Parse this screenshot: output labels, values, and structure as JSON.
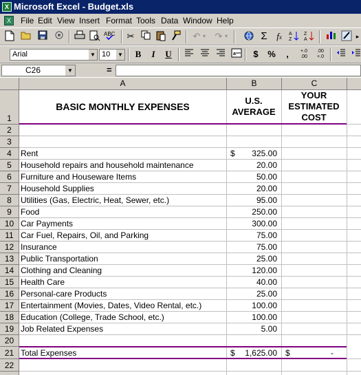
{
  "window": {
    "title": "Microsoft Excel - Budget.xls",
    "app_icon_glyph": "X"
  },
  "menu": [
    "File",
    "Edit",
    "View",
    "Insert",
    "Format",
    "Tools",
    "Data",
    "Window",
    "Help"
  ],
  "font_toolbar": {
    "font_name": "Arial",
    "font_size": "10",
    "bold": "B",
    "italic": "I",
    "underline": "U",
    "currency": "$",
    "percent": "%",
    "comma": ",",
    "inc_decimal": "+.0 .00",
    "dec_decimal": ".00 +.0"
  },
  "formula_bar": {
    "name_box": "C26",
    "equals": "=",
    "formula": ""
  },
  "columns": [
    "A",
    "B",
    "C"
  ],
  "header": {
    "a1": "BASIC MONTHLY EXPENSES",
    "b1_line1": "U.S.",
    "b1_line2": "AVERAGE",
    "c1_line1": "YOUR",
    "c1_line2": "ESTIMATED",
    "c1_line3": "COST"
  },
  "expenses": [
    {
      "row": "4",
      "item": "Rent",
      "currency": "$",
      "amount": "325.00"
    },
    {
      "row": "5",
      "item": "Household repairs and household maintenance",
      "currency": "",
      "amount": "20.00"
    },
    {
      "row": "6",
      "item": "Furniture and Houseware Items",
      "currency": "",
      "amount": "50.00"
    },
    {
      "row": "7",
      "item": "Household Supplies",
      "currency": "",
      "amount": "20.00"
    },
    {
      "row": "8",
      "item": "Utilities (Gas, Electric, Heat, Sewer, etc.)",
      "currency": "",
      "amount": "95.00"
    },
    {
      "row": "9",
      "item": "Food",
      "currency": "",
      "amount": "250.00"
    },
    {
      "row": "10",
      "item": "Car Payments",
      "currency": "",
      "amount": "300.00"
    },
    {
      "row": "11",
      "item": "Car Fuel, Repairs, Oil, and Parking",
      "currency": "",
      "amount": "75.00"
    },
    {
      "row": "12",
      "item": "Insurance",
      "currency": "",
      "amount": "75.00"
    },
    {
      "row": "13",
      "item": "Public Transportation",
      "currency": "",
      "amount": "25.00"
    },
    {
      "row": "14",
      "item": "Clothing and Cleaning",
      "currency": "",
      "amount": "120.00"
    },
    {
      "row": "15",
      "item": "Health Care",
      "currency": "",
      "amount": "40.00"
    },
    {
      "row": "16",
      "item": "Personal-care Products",
      "currency": "",
      "amount": "25.00"
    },
    {
      "row": "17",
      "item": "Entertainment (Movies, Dates, Video Rental, etc.)",
      "currency": "",
      "amount": "100.00"
    },
    {
      "row": "18",
      "item": "Education (College, Trade School, etc.)",
      "currency": "",
      "amount": "100.00"
    },
    {
      "row": "19",
      "item": "Job Related Expenses",
      "currency": "",
      "amount": "5.00"
    }
  ],
  "total": {
    "label": "Total Expenses",
    "b_currency": "$",
    "b_amount": "1,625.00",
    "c_currency": "$",
    "c_amount": "-"
  },
  "colors": {
    "title_bar": "#0a246a",
    "chrome": "#d4d0c8",
    "border_accent": "#800080"
  }
}
